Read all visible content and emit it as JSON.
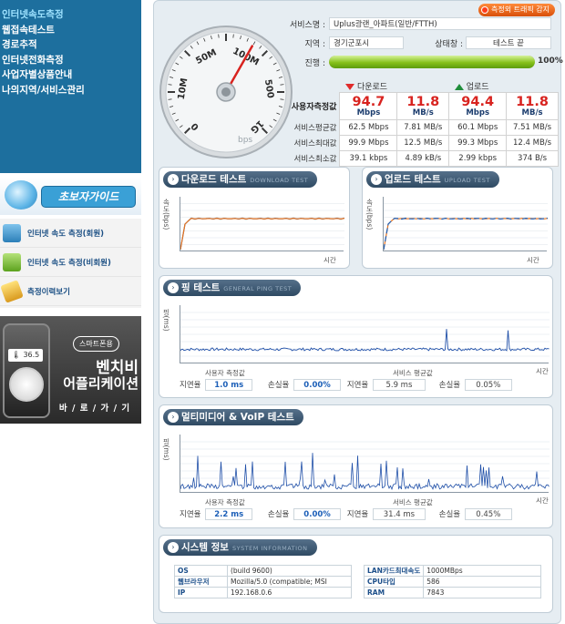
{
  "sidebar": {
    "menu": [
      {
        "label": "인터넷속도측정",
        "active": true
      },
      {
        "label": "웹접속테스트",
        "active": false
      },
      {
        "label": "경로추적",
        "active": false
      },
      {
        "label": "인터넷전화측정",
        "active": false
      },
      {
        "label": "사업자별상품안내",
        "active": false
      },
      {
        "label": "나의지역/서비스관리",
        "active": false
      }
    ],
    "guide_label": "초보자가이드",
    "quick_links": [
      {
        "label": "인터넷 속도 측정(회원)",
        "icon": "pc-icon"
      },
      {
        "label": "인터넷 속도 측정(비회원)",
        "icon": "laptop-icon"
      },
      {
        "label": "측정이력보기",
        "icon": "pencil-icon"
      }
    ],
    "app_banner": {
      "temperature": "36.5",
      "badge": "스마트폰용",
      "title_line1": "벤치비",
      "title_line2": "어플리케이션",
      "coming": "바 / 로 / 가 / 기"
    }
  },
  "header": {
    "report_button": "측정외 트래픽 감지",
    "service_label": "서비스명 :",
    "service_value": "Uplus광랜_아파트(일반/FTTH)",
    "region_label": "지역 :",
    "region_value": "경기군포시",
    "status_label": "상태창 :",
    "status_value": "테스트 끝",
    "progress_label": "진행 :",
    "progress_percent": 100,
    "progress_text": "100%"
  },
  "speedometer": {
    "ticks": [
      "0",
      "10M",
      "50M",
      "100M",
      "500",
      "1G"
    ],
    "needle_value_label": "100M",
    "unit": "bps"
  },
  "speed_table": {
    "download_head": "다운로드",
    "upload_head": "업로드",
    "measured_label": "사용자측정값",
    "download_mbps": "94.7",
    "download_mbps_unit": "Mbps",
    "download_mbs": "11.8",
    "download_mbs_unit": "MB/s",
    "upload_mbps": "94.4",
    "upload_mbps_unit": "Mbps",
    "upload_mbs": "11.8",
    "upload_mbs_unit": "MB/s",
    "rows": [
      {
        "label": "서비스평균값",
        "values": [
          "62.5 Mbps",
          "7.81 MB/s",
          "60.1 Mbps",
          "7.51 MB/s"
        ]
      },
      {
        "label": "서비스최대값",
        "values": [
          "99.9 Mbps",
          "12.5 MB/s",
          "99.3 Mbps",
          "12.4 MB/s"
        ]
      },
      {
        "label": "서비스최소값",
        "values": [
          "39.1 kbps",
          "4.89 kB/s",
          "2.99 kbps",
          "374 B/s"
        ]
      }
    ]
  },
  "download_test": {
    "title": "다운로드 테스트",
    "sub": "DOWNLOAD TEST",
    "ylabel": "속도(bps)",
    "xlabel": "시간"
  },
  "upload_test": {
    "title": "업로드 테스트",
    "sub": "UPLOAD TEST",
    "ylabel": "속도(bps)",
    "xlabel": "시간"
  },
  "ping_test": {
    "title": "핑 테스트",
    "sub": "GENERAL PING TEST",
    "ylabel": "핑(ms)",
    "xlabel": "시간",
    "user_label": "사용자 측정값",
    "service_label": "서비스 평균값",
    "latency_label": "지연율",
    "loss_label": "손실율",
    "user_latency": "1.0 ms",
    "user_loss": "0.00%",
    "service_latency": "5.9 ms",
    "service_loss": "0.05%"
  },
  "voip_test": {
    "title": "멀티미디어 & VoIP 테스트",
    "ylabel": "핑(ms)",
    "xlabel": "시간",
    "user_label": "사용자 측정값",
    "service_label": "서비스 평균값",
    "latency_label": "지연율",
    "loss_label": "손실율",
    "user_latency": "2.2 ms",
    "user_loss": "0.00%",
    "service_latency": "31.4 ms",
    "service_loss": "0.45%"
  },
  "system_info": {
    "title": "시스템 정보",
    "sub": "SYSTEM INFORMATION",
    "left": [
      {
        "k": "OS",
        "v": "(build 9600)"
      },
      {
        "k": "웹브라우저",
        "v": "Mozilla/5.0 (compatible; MSI"
      },
      {
        "k": "IP",
        "v": "192.168.0.6"
      }
    ],
    "right": [
      {
        "k": "LAN카드최대속도",
        "v": "1000MBps"
      },
      {
        "k": "CPU타입",
        "v": "586"
      },
      {
        "k": "RAM",
        "v": "7843"
      }
    ]
  },
  "colors": {
    "download_line": "#e8731c",
    "upload_line": "#1c5fb8",
    "ping_line": "#1f4fa8",
    "accent": "#1d6f9e"
  }
}
